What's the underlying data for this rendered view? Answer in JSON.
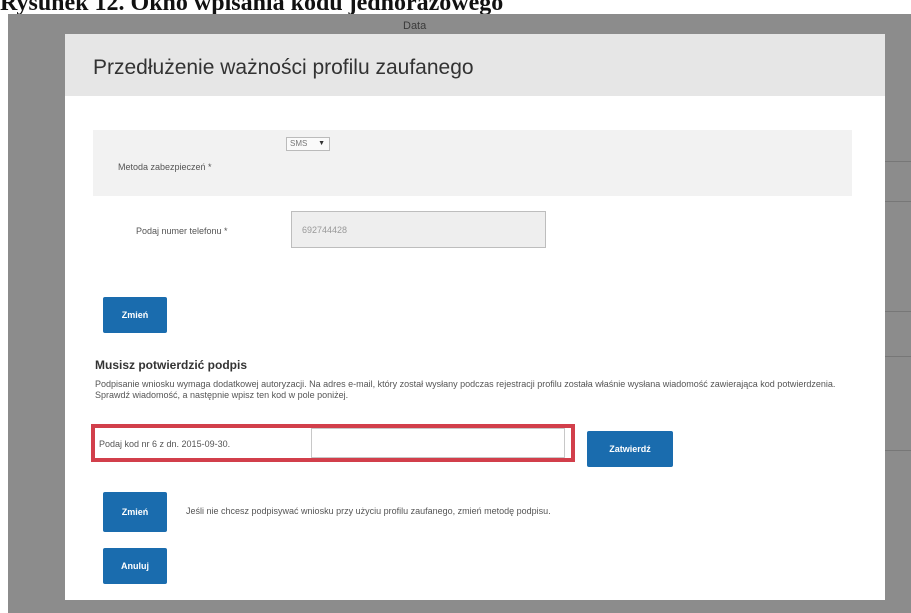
{
  "caption": "Rysunek 12. Okno wpisania kodu jednorazowego",
  "background": {
    "column_header": "Data"
  },
  "modal": {
    "title": "Przedłużenie ważności profilu zaufanego",
    "security_method": {
      "label": "Metoda zabezpieczeń *",
      "selected": "SMS"
    },
    "phone": {
      "label": "Podaj numer telefonu *",
      "value": "692744428"
    },
    "change_button": "Zmień",
    "signature": {
      "heading": "Musisz potwierdzić podpis",
      "description": "Podpisanie wniosku wymaga dodatkowej autoryzacji. Na adres e-mail, który został wysłany podczas rejestracji profilu została właśnie wysłana wiadomość zawierająca kod potwierdzenia. Sprawdź wiadomość, a następnie wpisz ten kod w pole poniżej.",
      "code_label": "Podaj kod nr 6 z dn. 2015-09-30.",
      "code_value": "",
      "confirm_button": "Zatwierdź"
    },
    "change_method": {
      "button": "Zmień",
      "note": "Jeśli nie chcesz podpisywać wniosku przy użyciu profilu zaufanego, zmień metodę podpisu."
    },
    "cancel_button": "Anuluj"
  },
  "colors": {
    "primary_button": "#1a6cae",
    "highlight_border": "#d23f4b",
    "overlay": "#8c8c8c"
  }
}
